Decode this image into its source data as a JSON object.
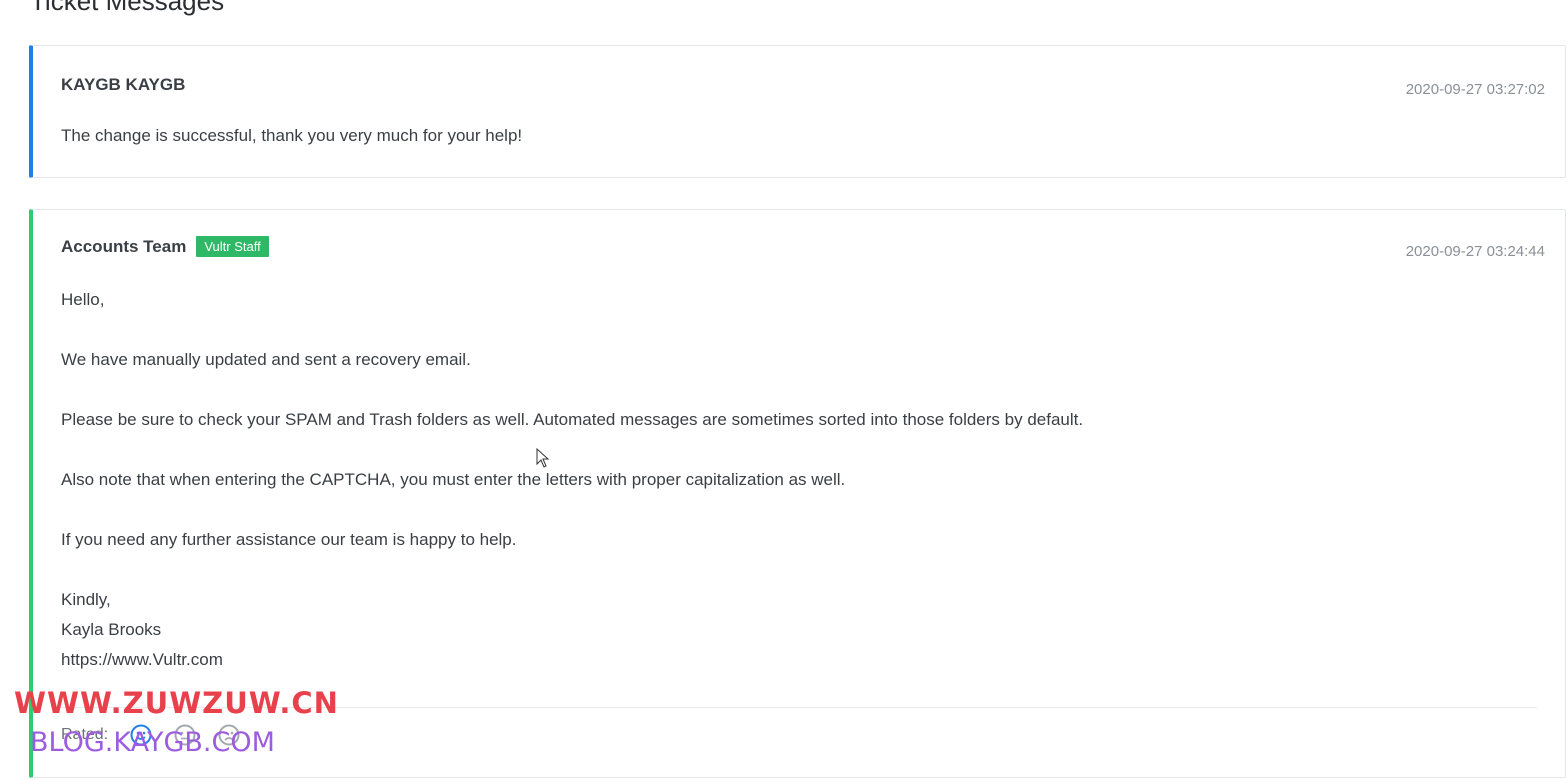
{
  "page": {
    "title": "Ticket Messages"
  },
  "messages": [
    {
      "author": "KAYGB KAYGB",
      "badge": "",
      "timestamp": "2020-09-27 03:27:02",
      "lines": [
        "The change is successful, thank you very much for your help!"
      ]
    },
    {
      "author": "Accounts Team",
      "badge": "Vultr Staff",
      "timestamp": "2020-09-27 03:24:44",
      "lines": [
        "Hello,",
        "We have manually updated and sent a recovery email.",
        "Please be sure to check your SPAM and Trash folders as well. Automated messages are sometimes sorted into those folders by default.",
        "Also note that when entering the CAPTCHA, you must enter the letters with proper capitalization as well.",
        "If you need any further assistance our team is happy to help.",
        "Kindly,",
        "Kayla Brooks",
        "https://www.Vultr.com"
      ],
      "rating": {
        "label": "Rated:",
        "icons": [
          "happy-face-icon",
          "neutral-face-icon",
          "sad-face-icon"
        ]
      }
    }
  ],
  "watermarks": {
    "primary": "WWW.ZUWZUW.CN",
    "secondary": "BLOG.KAYGB.COM"
  },
  "colors": {
    "user_accent": "#1e7fe6",
    "staff_accent": "#2ecc71",
    "badge_bg": "#2fb865",
    "watermark_red": "#e8414b",
    "watermark_purple": "#9d5ce0"
  }
}
